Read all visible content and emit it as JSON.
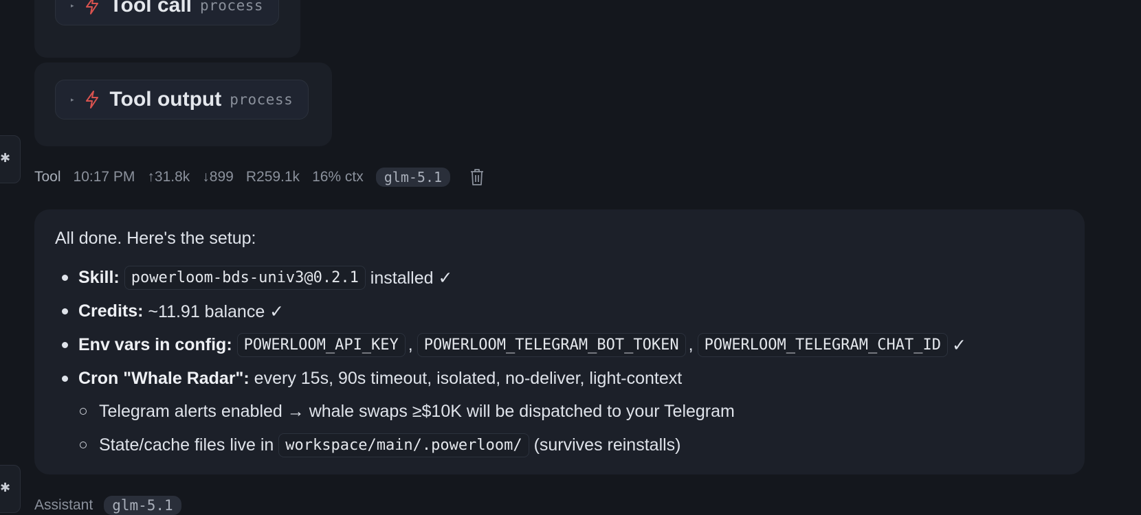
{
  "tool_call_card": {
    "title": "Tool call",
    "tag": "process"
  },
  "tool_output_card": {
    "title": "Tool output",
    "tag": "process"
  },
  "meta": {
    "role": "Tool",
    "time": "10:17 PM",
    "tokens_up": "↑31.8k",
    "tokens_down": "↓899",
    "reads": "R259.1k",
    "ctx": "16% ctx",
    "model": "glm-5.1"
  },
  "message": {
    "intro": "All done. Here's the setup:",
    "skill_label": "Skill:",
    "skill_code": "powerloom-bds-univ3@0.2.1",
    "skill_tail": " installed ✓",
    "credits_label": "Credits:",
    "credits_text": " ~11.91 balance ✓",
    "env_label": "Env vars in config:",
    "env_vars": [
      "POWERLOOM_API_KEY",
      "POWERLOOM_TELEGRAM_BOT_TOKEN",
      "POWERLOOM_TELEGRAM_CHAT_ID"
    ],
    "env_sep": ",",
    "env_tail": "✓",
    "cron_label": "Cron \"Whale Radar\":",
    "cron_text": " every 15s, 90s timeout, isolated, no-deliver, light-context",
    "sub1": "Telegram alerts enabled → whale swaps ≥$10K will be dispatched to your Telegram",
    "sub2_pre": "State/cache files live in ",
    "sub2_code": "workspace/main/.powerloom/",
    "sub2_post": " (survives reinstalls)"
  },
  "next_meta": {
    "role": "Assistant",
    "model": "glm-5.1"
  },
  "colors": {
    "bolt": "#d9534f",
    "background": "#14171d",
    "bubble": "#1c2029"
  }
}
